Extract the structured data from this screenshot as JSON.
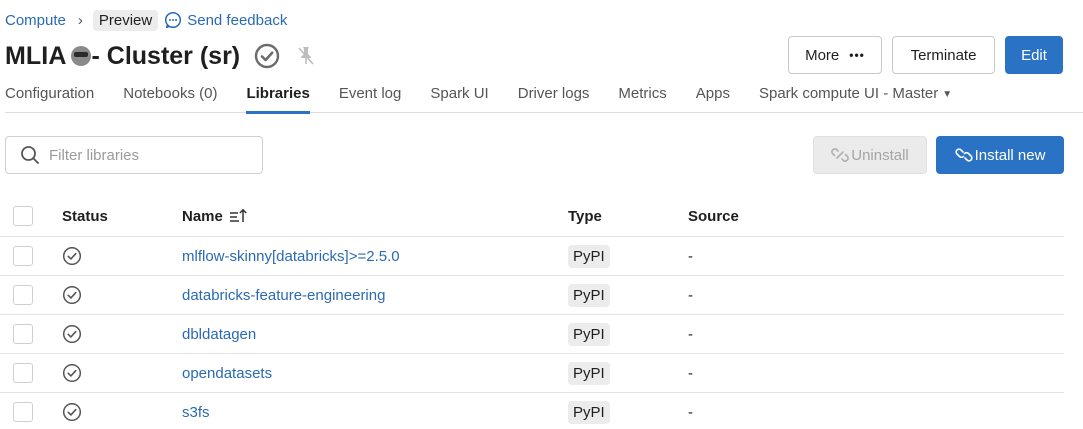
{
  "breadcrumb": {
    "compute": "Compute",
    "separator": "›",
    "preview": "Preview",
    "feedback": "Send feedback"
  },
  "title": {
    "name": "MLIA",
    "suffix": "- Cluster (sr)"
  },
  "actions": {
    "more": "More",
    "more_dots": "•••",
    "terminate": "Terminate",
    "edit": "Edit"
  },
  "tabs": [
    {
      "label": "Configuration",
      "active": false
    },
    {
      "label": "Notebooks (0)",
      "active": false
    },
    {
      "label": "Libraries",
      "active": true
    },
    {
      "label": "Event log",
      "active": false
    },
    {
      "label": "Spark UI",
      "active": false
    },
    {
      "label": "Driver logs",
      "active": false
    },
    {
      "label": "Metrics",
      "active": false
    },
    {
      "label": "Apps",
      "active": false
    },
    {
      "label": "Spark compute UI - Master",
      "active": false
    }
  ],
  "filter": {
    "placeholder": "Filter libraries",
    "value": ""
  },
  "toolbar": {
    "uninstall": "Uninstall",
    "install_new": "Install new"
  },
  "table": {
    "headers": {
      "status": "Status",
      "name": "Name",
      "type": "Type",
      "source": "Source"
    },
    "rows": [
      {
        "status": "installed",
        "name": "mlflow-skinny[databricks]>=2.5.0",
        "type": "PyPI",
        "source": "-"
      },
      {
        "status": "installed",
        "name": "databricks-feature-engineering",
        "type": "PyPI",
        "source": "-"
      },
      {
        "status": "installed",
        "name": "dbldatagen",
        "type": "PyPI",
        "source": "-"
      },
      {
        "status": "installed",
        "name": "opendatasets",
        "type": "PyPI",
        "source": "-"
      },
      {
        "status": "installed",
        "name": "s3fs",
        "type": "PyPI",
        "source": "-"
      }
    ]
  },
  "colors": {
    "accent": "#2a73c4",
    "link": "#2a6ab3",
    "status_icon": "#555555"
  }
}
